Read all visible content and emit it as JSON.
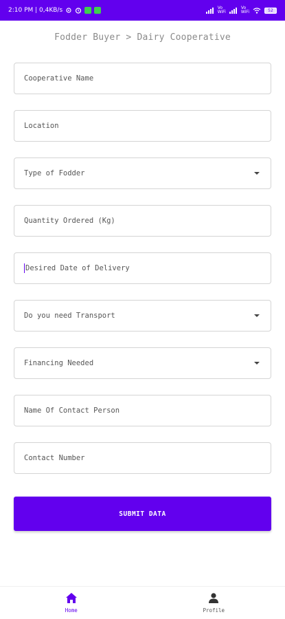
{
  "status_bar": {
    "time_network": "2:10 PM | 0,4KB/s",
    "signal1_label": "Vo\nWiFi",
    "signal2_label": "Vo\nWiFi",
    "battery": "52"
  },
  "page": {
    "title": "Fodder Buyer > Dairy Cooperative"
  },
  "form": {
    "fields": [
      {
        "placeholder": "Cooperative Name",
        "type": "text"
      },
      {
        "placeholder": "Location",
        "type": "text"
      },
      {
        "placeholder": "Type of Fodder",
        "type": "dropdown"
      },
      {
        "placeholder": "Quantity Ordered (Kg)",
        "type": "text"
      },
      {
        "placeholder": "Desired Date of Delivery",
        "type": "text",
        "focused": true
      },
      {
        "placeholder": "Do you need Transport",
        "type": "dropdown"
      },
      {
        "placeholder": "Financing Needed",
        "type": "dropdown"
      },
      {
        "placeholder": "Name Of Contact Person",
        "type": "text"
      },
      {
        "placeholder": "Contact Number",
        "type": "text"
      }
    ],
    "submit_label": "SUBMIT DATA"
  },
  "bottom_nav": {
    "items": [
      {
        "label": "Home",
        "icon": "home-icon",
        "active": true
      },
      {
        "label": "Profile",
        "icon": "person-icon",
        "active": false
      }
    ]
  },
  "colors": {
    "accent": "#6200ee",
    "border": "#d4d4d4"
  }
}
